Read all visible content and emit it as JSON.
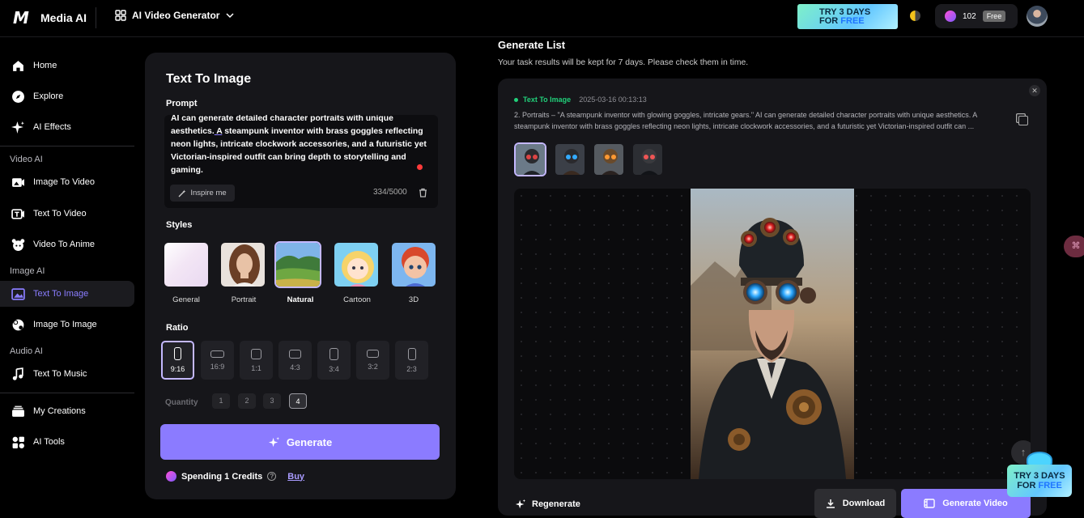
{
  "topbar": {
    "brand": "Media AI",
    "app_switch": "AI Video Generator",
    "promo": {
      "line1": "TRY 3 DAYS",
      "line2a": "FOR ",
      "line2b": "FREE"
    },
    "credits": "102",
    "plan": "Free"
  },
  "sidebar": {
    "items": [
      {
        "label": "Home",
        "icon": "home-icon"
      },
      {
        "label": "Explore",
        "icon": "compass-icon"
      },
      {
        "label": "AI Effects",
        "icon": "sparkle-icon"
      }
    ],
    "video_group": "Video AI",
    "video_items": [
      {
        "label": "Image To Video"
      },
      {
        "label": "Text To Video"
      },
      {
        "label": "Video To Anime"
      }
    ],
    "image_group": "Image AI",
    "image_items": [
      {
        "label": "Text To Image",
        "active": true
      },
      {
        "label": "Image To Image"
      }
    ],
    "audio_group": "Audio AI",
    "audio_items": [
      {
        "label": "Text To Music"
      }
    ],
    "bottom_items": [
      {
        "label": "My Creations"
      },
      {
        "label": "AI Tools"
      }
    ]
  },
  "panel": {
    "title": "Text To Image",
    "prompt_label": "Prompt",
    "prompt_text_pre": "AI can generate detailed character portraits with unique aesthetics.",
    "prompt_text_a": " A",
    "prompt_text_post": " steampunk inventor with brass goggles reflecting neon lights, intricate clockwork accessories, and a futuristic yet Victorian-inspired outfit can bring depth to storytelling and gaming.",
    "inspire": "Inspire me",
    "counter": "334/5000",
    "styles_label": "Styles",
    "styles": [
      "General",
      "Portrait",
      "Natural",
      "Cartoon",
      "3D"
    ],
    "selected_style": "Natural",
    "ratio_label": "Ratio",
    "ratios": [
      "9:16",
      "16:9",
      "1:1",
      "4:3",
      "3:4",
      "3:2",
      "2:3"
    ],
    "selected_ratio": "9:16",
    "quantity_label": "Quantity",
    "quantities": [
      "1",
      "2",
      "3",
      "4"
    ],
    "selected_quantity": "4",
    "generate": "Generate",
    "spending_pre": "Spending ",
    "spending_num": "1",
    "spending_post": " Credits",
    "buy": "Buy"
  },
  "generate_list": {
    "title": "Generate List",
    "subtitle": "Your task results will be kept for 7 days. Please check them in time.",
    "task": {
      "type": "Text To Image",
      "time": "2025-03-16 00:13:13",
      "desc": "2. Portraits – \"A steampunk inventor with glowing goggles, intricate gears.\" AI can generate detailed character portraits with unique aesthetics. A steampunk inventor with brass goggles reflecting neon lights, intricate clockwork accessories, and a futuristic yet Victorian-inspired outfit can ...",
      "regenerate": "Regenerate",
      "download": "Download",
      "generate_video": "Generate Video"
    }
  },
  "float_promo": {
    "line1": "TRY 3 DAYS",
    "line2a": "FOR ",
    "line2b": "FREE"
  },
  "colors": {
    "accent": "#8b7bff",
    "success": "#21d07a",
    "panel": "#16161a"
  }
}
